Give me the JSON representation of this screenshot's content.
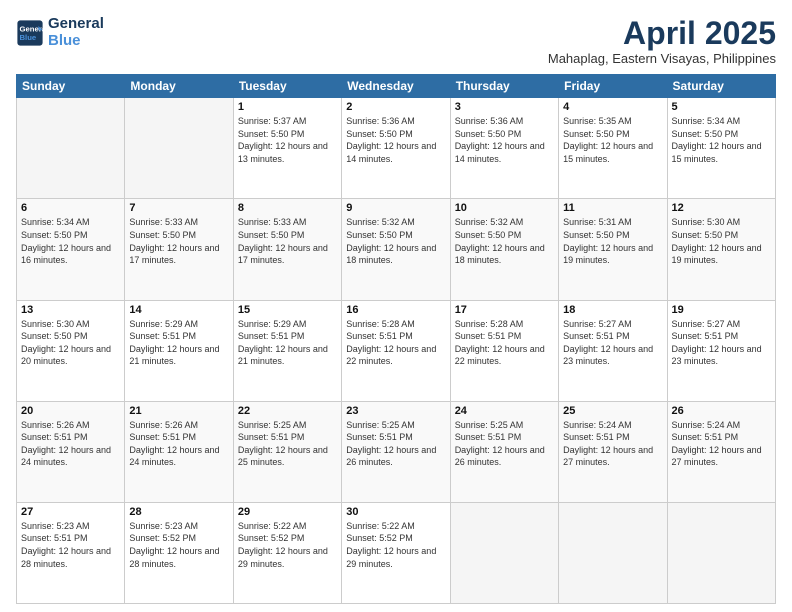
{
  "header": {
    "logo_line1": "General",
    "logo_line2": "Blue",
    "title": "April 2025",
    "subtitle": "Mahaplag, Eastern Visayas, Philippines"
  },
  "days_of_week": [
    "Sunday",
    "Monday",
    "Tuesday",
    "Wednesday",
    "Thursday",
    "Friday",
    "Saturday"
  ],
  "weeks": [
    [
      {
        "day": "",
        "empty": true
      },
      {
        "day": "",
        "empty": true
      },
      {
        "day": "1",
        "sunrise": "5:37 AM",
        "sunset": "5:50 PM",
        "daylight": "12 hours and 13 minutes."
      },
      {
        "day": "2",
        "sunrise": "5:36 AM",
        "sunset": "5:50 PM",
        "daylight": "12 hours and 14 minutes."
      },
      {
        "day": "3",
        "sunrise": "5:36 AM",
        "sunset": "5:50 PM",
        "daylight": "12 hours and 14 minutes."
      },
      {
        "day": "4",
        "sunrise": "5:35 AM",
        "sunset": "5:50 PM",
        "daylight": "12 hours and 15 minutes."
      },
      {
        "day": "5",
        "sunrise": "5:34 AM",
        "sunset": "5:50 PM",
        "daylight": "12 hours and 15 minutes."
      }
    ],
    [
      {
        "day": "6",
        "sunrise": "5:34 AM",
        "sunset": "5:50 PM",
        "daylight": "12 hours and 16 minutes."
      },
      {
        "day": "7",
        "sunrise": "5:33 AM",
        "sunset": "5:50 PM",
        "daylight": "12 hours and 17 minutes."
      },
      {
        "day": "8",
        "sunrise": "5:33 AM",
        "sunset": "5:50 PM",
        "daylight": "12 hours and 17 minutes."
      },
      {
        "day": "9",
        "sunrise": "5:32 AM",
        "sunset": "5:50 PM",
        "daylight": "12 hours and 18 minutes."
      },
      {
        "day": "10",
        "sunrise": "5:32 AM",
        "sunset": "5:50 PM",
        "daylight": "12 hours and 18 minutes."
      },
      {
        "day": "11",
        "sunrise": "5:31 AM",
        "sunset": "5:50 PM",
        "daylight": "12 hours and 19 minutes."
      },
      {
        "day": "12",
        "sunrise": "5:30 AM",
        "sunset": "5:50 PM",
        "daylight": "12 hours and 19 minutes."
      }
    ],
    [
      {
        "day": "13",
        "sunrise": "5:30 AM",
        "sunset": "5:50 PM",
        "daylight": "12 hours and 20 minutes."
      },
      {
        "day": "14",
        "sunrise": "5:29 AM",
        "sunset": "5:51 PM",
        "daylight": "12 hours and 21 minutes."
      },
      {
        "day": "15",
        "sunrise": "5:29 AM",
        "sunset": "5:51 PM",
        "daylight": "12 hours and 21 minutes."
      },
      {
        "day": "16",
        "sunrise": "5:28 AM",
        "sunset": "5:51 PM",
        "daylight": "12 hours and 22 minutes."
      },
      {
        "day": "17",
        "sunrise": "5:28 AM",
        "sunset": "5:51 PM",
        "daylight": "12 hours and 22 minutes."
      },
      {
        "day": "18",
        "sunrise": "5:27 AM",
        "sunset": "5:51 PM",
        "daylight": "12 hours and 23 minutes."
      },
      {
        "day": "19",
        "sunrise": "5:27 AM",
        "sunset": "5:51 PM",
        "daylight": "12 hours and 23 minutes."
      }
    ],
    [
      {
        "day": "20",
        "sunrise": "5:26 AM",
        "sunset": "5:51 PM",
        "daylight": "12 hours and 24 minutes."
      },
      {
        "day": "21",
        "sunrise": "5:26 AM",
        "sunset": "5:51 PM",
        "daylight": "12 hours and 24 minutes."
      },
      {
        "day": "22",
        "sunrise": "5:25 AM",
        "sunset": "5:51 PM",
        "daylight": "12 hours and 25 minutes."
      },
      {
        "day": "23",
        "sunrise": "5:25 AM",
        "sunset": "5:51 PM",
        "daylight": "12 hours and 26 minutes."
      },
      {
        "day": "24",
        "sunrise": "5:25 AM",
        "sunset": "5:51 PM",
        "daylight": "12 hours and 26 minutes."
      },
      {
        "day": "25",
        "sunrise": "5:24 AM",
        "sunset": "5:51 PM",
        "daylight": "12 hours and 27 minutes."
      },
      {
        "day": "26",
        "sunrise": "5:24 AM",
        "sunset": "5:51 PM",
        "daylight": "12 hours and 27 minutes."
      }
    ],
    [
      {
        "day": "27",
        "sunrise": "5:23 AM",
        "sunset": "5:51 PM",
        "daylight": "12 hours and 28 minutes."
      },
      {
        "day": "28",
        "sunrise": "5:23 AM",
        "sunset": "5:52 PM",
        "daylight": "12 hours and 28 minutes."
      },
      {
        "day": "29",
        "sunrise": "5:22 AM",
        "sunset": "5:52 PM",
        "daylight": "12 hours and 29 minutes."
      },
      {
        "day": "30",
        "sunrise": "5:22 AM",
        "sunset": "5:52 PM",
        "daylight": "12 hours and 29 minutes."
      },
      {
        "day": "",
        "empty": true
      },
      {
        "day": "",
        "empty": true
      },
      {
        "day": "",
        "empty": true
      }
    ]
  ]
}
